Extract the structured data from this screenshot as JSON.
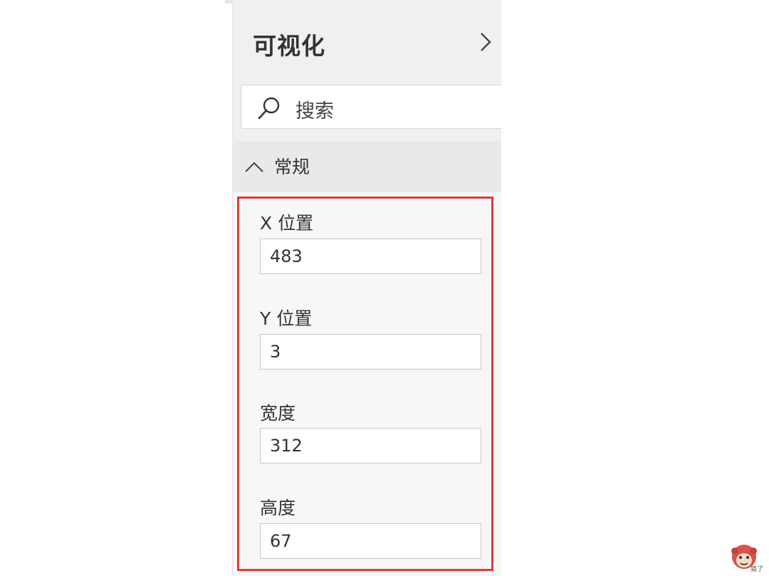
{
  "panel": {
    "title": "可视化"
  },
  "search": {
    "placeholder": "搜索"
  },
  "section": {
    "label": "常规",
    "fields": [
      {
        "label": "X 位置",
        "value": "483"
      },
      {
        "label": "Y 位置",
        "value": "3"
      },
      {
        "label": "宽度",
        "value": "312"
      },
      {
        "label": "高度",
        "value": "67"
      }
    ]
  },
  "colors": {
    "highlight": "#e03a3a",
    "panel_bg": "#f0f0f0",
    "section_bg": "#e9e9e9"
  },
  "icons": {
    "expand": "chevron-right-icon",
    "search": "search-icon",
    "collapse": "chevron-up-icon",
    "watermark": "monkey-logo-icon"
  },
  "watermark": {
    "text": "猿了"
  }
}
